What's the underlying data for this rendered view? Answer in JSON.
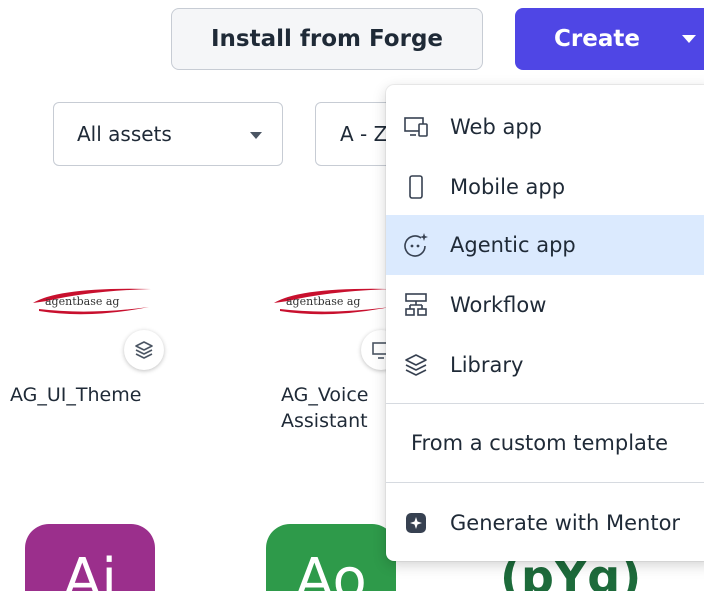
{
  "toolbar": {
    "install_label": "Install from Forge",
    "create_label": "Create"
  },
  "filters": {
    "assets_selected": "All assets",
    "sort_selected": "A - Z"
  },
  "assets": [
    {
      "name": "AG_UI_Theme",
      "logo_text": "agentbase ag",
      "type_icon": "library-icon"
    },
    {
      "name_line1": "AG_Voice",
      "name_line2": "Assistant",
      "logo_text": "agentbase ag",
      "type_icon": "web-app-icon"
    }
  ],
  "tiles": [
    {
      "label": "Ai",
      "color": "#9b2f8c"
    },
    {
      "label": "Ao",
      "color": "#2e9a4a"
    },
    {
      "label": "(pYg)",
      "color": "#1d6b3b"
    }
  ],
  "create_menu": {
    "items": [
      {
        "label": "Web app",
        "icon": "web-app-icon"
      },
      {
        "label": "Mobile app",
        "icon": "mobile-app-icon"
      },
      {
        "label": "Agentic app",
        "icon": "agentic-app-icon",
        "highlighted": true
      },
      {
        "label": "Workflow",
        "icon": "workflow-icon"
      },
      {
        "label": "Library",
        "icon": "library-icon"
      }
    ],
    "custom_template_label": "From a custom template",
    "mentor_label": "Generate with Mentor"
  },
  "colors": {
    "primary": "#4f46e5",
    "highlight": "#dbeafe",
    "logo_red": "#c8102e"
  }
}
